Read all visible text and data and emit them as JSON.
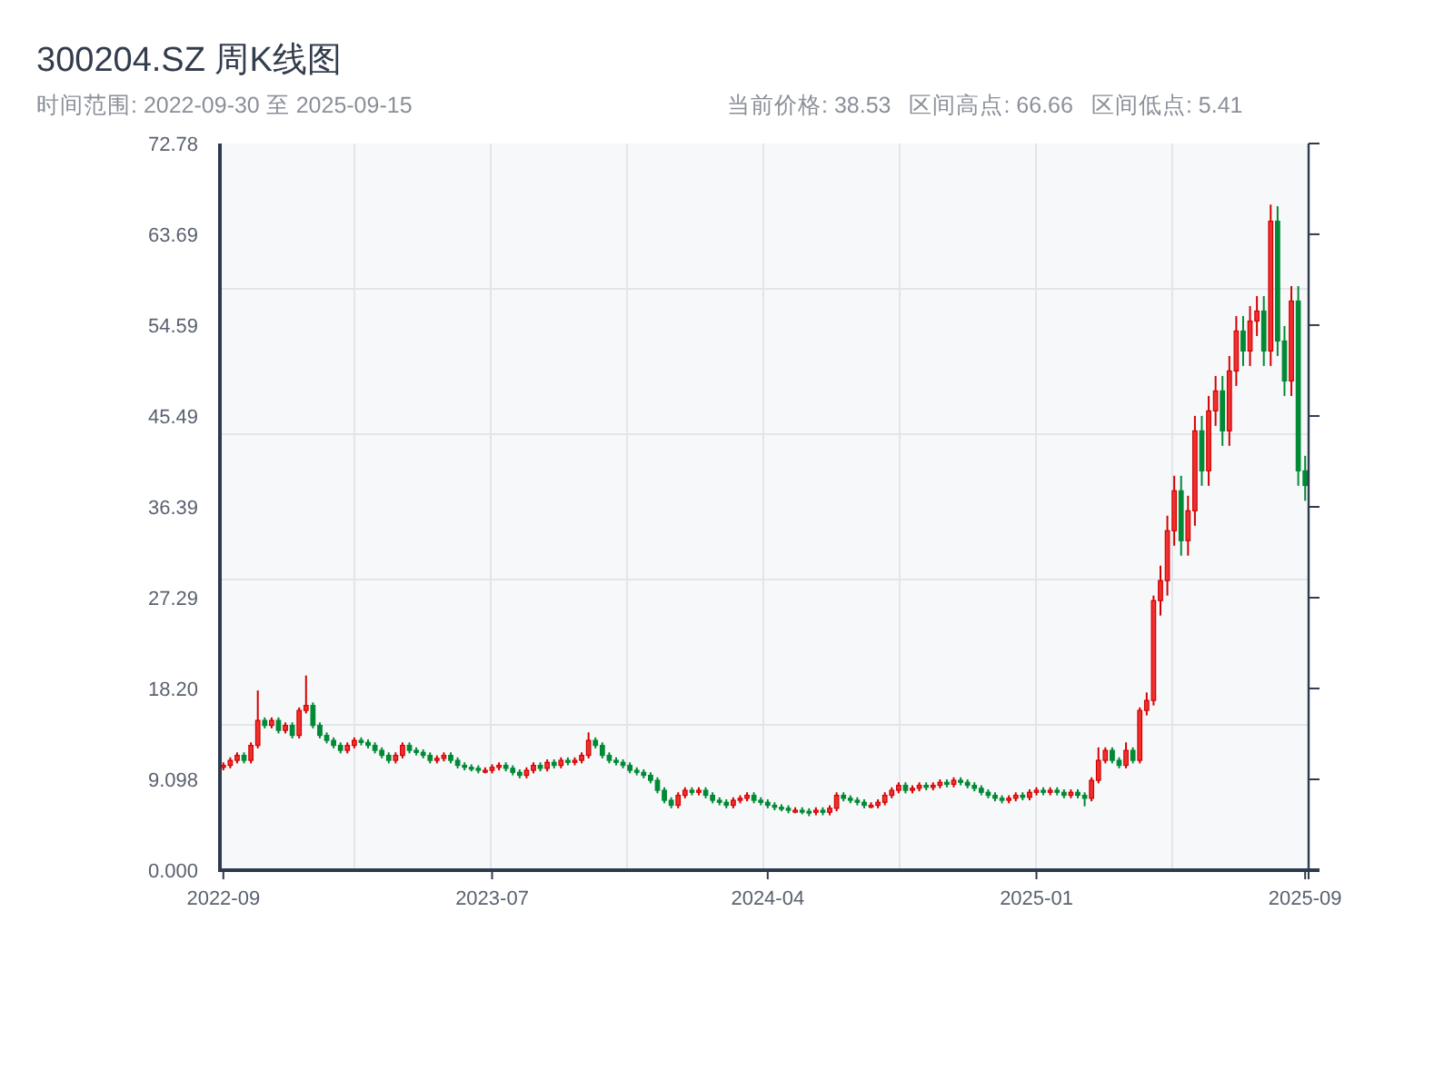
{
  "header": {
    "title": "300204.SZ 周K线图",
    "range_label": "时间范围: 2022-09-30 至 2025-09-15",
    "stats": [
      {
        "text": "当前价格: 38.53"
      },
      {
        "text": "区间高点: 66.66"
      },
      {
        "text": "区间低点: 5.41"
      }
    ]
  },
  "chart": {
    "chart_data": {
      "type": "candlestick",
      "ylim": [
        0,
        72.78
      ],
      "categories": [
        "2022-09",
        null,
        null,
        null,
        null,
        null,
        null,
        null,
        null,
        null,
        null,
        null,
        null,
        null,
        null,
        null,
        null,
        null,
        null,
        null,
        null,
        null,
        null,
        null,
        null,
        null,
        null,
        null,
        null,
        null,
        null,
        null,
        null,
        null,
        null,
        null,
        null,
        null,
        null,
        "2023-07",
        null,
        null,
        null,
        null,
        null,
        null,
        null,
        null,
        null,
        null,
        null,
        null,
        null,
        null,
        null,
        null,
        null,
        null,
        null,
        null,
        null,
        null,
        null,
        null,
        null,
        null,
        null,
        null,
        null,
        null,
        null,
        null,
        null,
        null,
        null,
        null,
        null,
        null,
        null,
        "2024-04",
        null,
        null,
        null,
        null,
        null,
        null,
        null,
        null,
        null,
        null,
        null,
        null,
        null,
        null,
        null,
        null,
        null,
        null,
        null,
        null,
        null,
        null,
        null,
        null,
        null,
        null,
        null,
        null,
        null,
        null,
        null,
        null,
        null,
        null,
        null,
        null,
        null,
        null,
        "2025-01",
        null,
        null,
        null,
        null,
        null,
        null,
        null,
        null,
        null,
        null,
        null,
        null,
        null,
        null,
        null,
        null,
        null,
        null,
        null,
        null,
        null,
        null,
        null,
        null,
        null,
        null,
        null,
        null,
        null,
        null,
        null,
        null,
        null,
        null,
        null,
        null,
        null,
        null,
        "2025-09"
      ],
      "yticks": [
        {
          "value": 0,
          "label": "0.000"
        },
        {
          "value": 9.098,
          "label": "9.098"
        },
        {
          "value": 18.2,
          "label": "18.20"
        },
        {
          "value": 27.29,
          "label": "27.29"
        },
        {
          "value": 36.39,
          "label": "36.39"
        },
        {
          "value": 45.49,
          "label": "45.49"
        },
        {
          "value": 54.59,
          "label": "54.59"
        },
        {
          "value": 63.69,
          "label": "63.69"
        },
        {
          "value": 72.78,
          "label": "72.78"
        }
      ],
      "ohlc": [
        [
          10.3,
          10.8,
          10.0,
          10.5
        ],
        [
          10.5,
          11.3,
          10.2,
          11
        ],
        [
          11,
          11.8,
          10.7,
          11.5
        ],
        [
          11.5,
          11.8,
          10.7,
          11
        ],
        [
          11,
          12.8,
          10.7,
          12.5
        ],
        [
          12.5,
          18,
          12.2,
          15
        ],
        [
          15,
          15.3,
          14.2,
          14.5
        ],
        [
          14.5,
          15.3,
          14.2,
          15
        ],
        [
          15,
          15.3,
          13.7,
          14
        ],
        [
          14,
          14.8,
          13.7,
          14.5
        ],
        [
          14.5,
          14.8,
          13.2,
          13.5
        ],
        [
          13.5,
          16.3,
          13.2,
          16
        ],
        [
          16,
          19.5,
          15.7,
          16.5
        ],
        [
          16.5,
          16.8,
          14.2,
          14.5
        ],
        [
          14.5,
          14.8,
          13.2,
          13.5
        ],
        [
          13.5,
          13.8,
          12.7,
          13
        ],
        [
          13,
          13.3,
          12.2,
          12.5
        ],
        [
          12.5,
          12.8,
          11.7,
          12
        ],
        [
          12,
          12.8,
          11.7,
          12.5
        ],
        [
          12.5,
          13.3,
          12.2,
          13
        ],
        [
          13,
          13.3,
          12.5,
          12.8
        ],
        [
          12.8,
          13.1,
          12.2,
          12.5
        ],
        [
          12.5,
          12.8,
          11.7,
          12
        ],
        [
          12,
          12.3,
          11.2,
          11.5
        ],
        [
          11.5,
          11.8,
          10.7,
          11
        ],
        [
          11,
          11.8,
          10.7,
          11.5
        ],
        [
          11.5,
          12.8,
          11.2,
          12.5
        ],
        [
          12.5,
          12.8,
          11.7,
          12
        ],
        [
          12,
          12.3,
          11.5,
          11.8
        ],
        [
          11.8,
          12.1,
          11.2,
          11.5
        ],
        [
          11.5,
          11.8,
          10.7,
          11
        ],
        [
          11,
          11.5,
          10.7,
          11.2
        ],
        [
          11.2,
          11.8,
          10.9,
          11.5
        ],
        [
          11.5,
          11.8,
          10.7,
          11
        ],
        [
          11,
          11.3,
          10.2,
          10.5
        ],
        [
          10.5,
          10.8,
          10,
          10.3
        ],
        [
          10.3,
          10.6,
          9.9,
          10.2
        ],
        [
          10.2,
          10.5,
          9.7,
          10
        ],
        [
          10,
          10.3,
          9.7,
          10
        ],
        [
          10,
          10.6,
          9.7,
          10.3
        ],
        [
          10.3,
          10.8,
          10,
          10.5
        ],
        [
          10.5,
          10.8,
          9.9,
          10.2
        ],
        [
          10.2,
          10.5,
          9.5,
          9.8
        ],
        [
          9.8,
          10.1,
          9.2,
          9.5
        ],
        [
          9.5,
          10.3,
          9.2,
          10
        ],
        [
          10,
          10.8,
          9.7,
          10.5
        ],
        [
          10.5,
          10.8,
          9.9,
          10.2
        ],
        [
          10.2,
          11.1,
          9.9,
          10.8
        ],
        [
          10.8,
          11.1,
          10.2,
          10.5
        ],
        [
          10.5,
          11.3,
          10.2,
          11
        ],
        [
          11,
          11.3,
          10.5,
          10.8
        ],
        [
          10.8,
          11.3,
          10.5,
          11
        ],
        [
          11,
          11.8,
          10.7,
          11.5
        ],
        [
          11.5,
          13.8,
          11.2,
          13
        ],
        [
          13,
          13.3,
          12.2,
          12.5
        ],
        [
          12.5,
          12.8,
          11.2,
          11.5
        ],
        [
          11.5,
          11.8,
          10.7,
          11
        ],
        [
          11,
          11.3,
          10.5,
          10.8
        ],
        [
          10.8,
          11.1,
          10.2,
          10.5
        ],
        [
          10.5,
          10.8,
          9.7,
          10
        ],
        [
          10,
          10.3,
          9.5,
          9.8
        ],
        [
          9.8,
          10.1,
          9.2,
          9.5
        ],
        [
          9.5,
          9.8,
          8.7,
          9
        ],
        [
          9,
          9.3,
          7.7,
          8
        ],
        [
          8,
          8.3,
          6.7,
          7
        ],
        [
          7,
          7.3,
          6.2,
          6.5
        ],
        [
          6.5,
          7.8,
          6.2,
          7.5
        ],
        [
          7.5,
          8.3,
          7.2,
          8
        ],
        [
          8,
          8.3,
          7.5,
          7.8
        ],
        [
          7.8,
          8.3,
          7.5,
          8
        ],
        [
          8,
          8.3,
          7.2,
          7.5
        ],
        [
          7.5,
          7.8,
          6.7,
          7
        ],
        [
          7,
          7.3,
          6.5,
          6.8
        ],
        [
          6.8,
          7.1,
          6.2,
          6.5
        ],
        [
          6.5,
          7.3,
          6.2,
          7
        ],
        [
          7,
          7.5,
          6.7,
          7.2
        ],
        [
          7.2,
          7.8,
          6.9,
          7.5
        ],
        [
          7.5,
          7.8,
          6.7,
          7
        ],
        [
          7,
          7.3,
          6.5,
          6.8
        ],
        [
          6.8,
          7.1,
          6.2,
          6.5
        ],
        [
          6.5,
          6.8,
          6,
          6.3
        ],
        [
          6.3,
          6.6,
          5.9,
          6.2
        ],
        [
          6.2,
          6.5,
          5.7,
          6
        ],
        [
          6,
          6.3,
          5.7,
          6
        ],
        [
          6,
          6.3,
          5.6,
          5.9
        ],
        [
          5.9,
          6.2,
          5.41,
          5.8
        ],
        [
          5.8,
          6.3,
          5.5,
          6
        ],
        [
          6,
          6.3,
          5.5,
          5.8
        ],
        [
          5.8,
          6.5,
          5.5,
          6.2
        ],
        [
          6.2,
          7.8,
          5.9,
          7.5
        ],
        [
          7.5,
          7.8,
          6.9,
          7.2
        ],
        [
          7.2,
          7.5,
          6.7,
          7
        ],
        [
          7,
          7.3,
          6.5,
          6.8
        ],
        [
          6.8,
          7.1,
          6.2,
          6.5
        ],
        [
          6.5,
          6.8,
          6.2,
          6.5
        ],
        [
          6.5,
          7.1,
          6.2,
          6.8
        ],
        [
          6.8,
          7.8,
          6.5,
          7.5
        ],
        [
          7.5,
          8.3,
          7.2,
          8
        ],
        [
          8,
          8.8,
          7.7,
          8.5
        ],
        [
          8.5,
          8.8,
          7.7,
          8
        ],
        [
          8,
          8.5,
          7.7,
          8.2
        ],
        [
          8.2,
          8.8,
          7.9,
          8.5
        ],
        [
          8.5,
          8.8,
          8,
          8.3
        ],
        [
          8.3,
          8.8,
          8,
          8.5
        ],
        [
          8.5,
          9.1,
          8.2,
          8.8
        ],
        [
          8.8,
          9.1,
          8.3,
          8.6
        ],
        [
          8.6,
          9.3,
          8.3,
          9
        ],
        [
          9,
          9.3,
          8.5,
          8.8
        ],
        [
          8.8,
          9.1,
          8.2,
          8.5
        ],
        [
          8.5,
          8.8,
          7.9,
          8.2
        ],
        [
          8.2,
          8.5,
          7.5,
          7.8
        ],
        [
          7.8,
          8.1,
          7.2,
          7.5
        ],
        [
          7.5,
          7.8,
          6.9,
          7.2
        ],
        [
          7.2,
          7.5,
          6.7,
          7
        ],
        [
          7,
          7.5,
          6.7,
          7.2
        ],
        [
          7.2,
          7.8,
          6.9,
          7.5
        ],
        [
          7.5,
          7.8,
          7,
          7.3
        ],
        [
          7.3,
          8.1,
          7,
          7.8
        ],
        [
          7.8,
          8.3,
          7.5,
          8
        ],
        [
          8,
          8.3,
          7.5,
          7.8
        ],
        [
          7.8,
          8.3,
          7.5,
          8
        ],
        [
          8,
          8.3,
          7.5,
          7.8
        ],
        [
          7.8,
          8.1,
          7.2,
          7.5
        ],
        [
          7.5,
          8.1,
          7.2,
          7.8
        ],
        [
          7.8,
          8.1,
          7.2,
          7.5
        ],
        [
          7.5,
          7.8,
          6.4,
          7.2
        ],
        [
          7.2,
          9.3,
          6.9,
          9
        ],
        [
          9,
          12.3,
          8.7,
          11
        ],
        [
          11,
          12.3,
          10.7,
          12
        ],
        [
          12,
          12.3,
          10.7,
          11
        ],
        [
          11,
          11.3,
          10.2,
          10.5
        ],
        [
          10.5,
          12.8,
          10.2,
          12
        ],
        [
          12,
          12.3,
          10.7,
          11
        ],
        [
          11,
          16.3,
          10.7,
          16
        ],
        [
          16,
          17.8,
          15.5,
          17
        ],
        [
          17,
          27.5,
          16.5,
          27
        ],
        [
          27,
          30.5,
          25.5,
          29
        ],
        [
          29,
          35.5,
          27.5,
          34
        ],
        [
          34,
          39.5,
          32.5,
          38
        ],
        [
          38,
          39.5,
          31.5,
          33
        ],
        [
          33,
          37.5,
          31.5,
          36
        ],
        [
          36,
          45.5,
          34.5,
          44
        ],
        [
          44,
          45.5,
          38.5,
          40
        ],
        [
          40,
          47.5,
          38.5,
          46
        ],
        [
          46,
          49.5,
          44.5,
          48
        ],
        [
          48,
          49.5,
          42.5,
          44
        ],
        [
          44,
          51.5,
          42.5,
          50
        ],
        [
          50,
          55.5,
          48.5,
          54
        ],
        [
          54,
          55.5,
          50.5,
          52
        ],
        [
          52,
          56.5,
          50.5,
          55
        ],
        [
          55,
          57.5,
          53.5,
          56
        ],
        [
          56,
          57.5,
          50.5,
          52
        ],
        [
          52,
          66.66,
          50.5,
          65
        ],
        [
          65,
          66.5,
          51.5,
          53
        ],
        [
          53,
          54.5,
          47.5,
          49
        ],
        [
          49,
          58.5,
          47.5,
          57
        ],
        [
          57,
          58.5,
          38.5,
          40
        ],
        [
          40,
          41.5,
          37,
          38.53
        ]
      ]
    }
  }
}
